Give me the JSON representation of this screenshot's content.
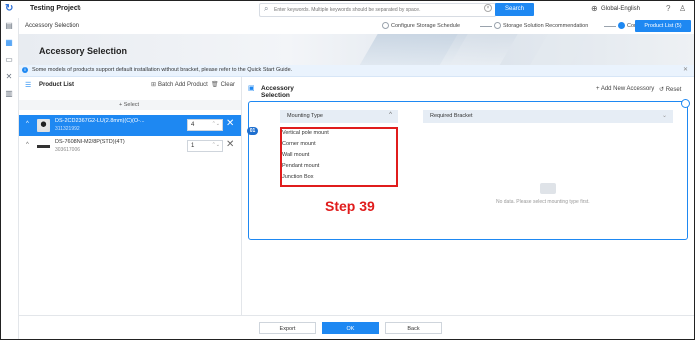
{
  "topbar": {
    "project_title": "Testing Project",
    "search_placeholder": "Enter keywords. Multiple keywords should be separated by space.",
    "search_button": "Search",
    "language": "Global-English"
  },
  "subbar": {
    "breadcrumb": "Accessory Selection",
    "steps": [
      {
        "label": "Configure Storage Schedule",
        "active": false
      },
      {
        "label": "Storage Solution Recommendation",
        "active": false
      },
      {
        "label": "Confirm List",
        "active": true
      }
    ],
    "product_list_button": "Product List (5)"
  },
  "banner": {
    "title": "Accessory Selection"
  },
  "notice": {
    "text": "Some models of products support default installation without bracket, please refer to the Quick Start Guide."
  },
  "product_list": {
    "title": "Product List",
    "batch_add": "Batch Add Product",
    "clear": "Clear",
    "select_label": "Select",
    "items": [
      {
        "name": "DS-2CD2367G2-LU(2.8mm)(C)(O-...",
        "code": "311321992",
        "qty": "4",
        "selected": true
      },
      {
        "name": "DS-7608NI-M2/8P(STD)(4T)",
        "code": "303617006",
        "qty": "1",
        "selected": false
      }
    ]
  },
  "accessory": {
    "title": "Accessory Selection",
    "add_button": "Add New Accessory",
    "reset_button": "Reset",
    "badge": "01",
    "mounting_type_label": "Mounting Type",
    "mounting_types": [
      "Vertical pole mount",
      "Corner mount",
      "Wall mount",
      "Pendant mount",
      "Junction Box"
    ],
    "required_bracket_label": "Required Bracket",
    "empty_text": "No data. Please select mounting type first."
  },
  "annotation": {
    "step_label": "Step 39"
  },
  "footer": {
    "export": "Export",
    "ok": "OK",
    "back": "Back"
  },
  "colors": {
    "accent": "#1e88f2",
    "highlight": "#e01c1c"
  }
}
